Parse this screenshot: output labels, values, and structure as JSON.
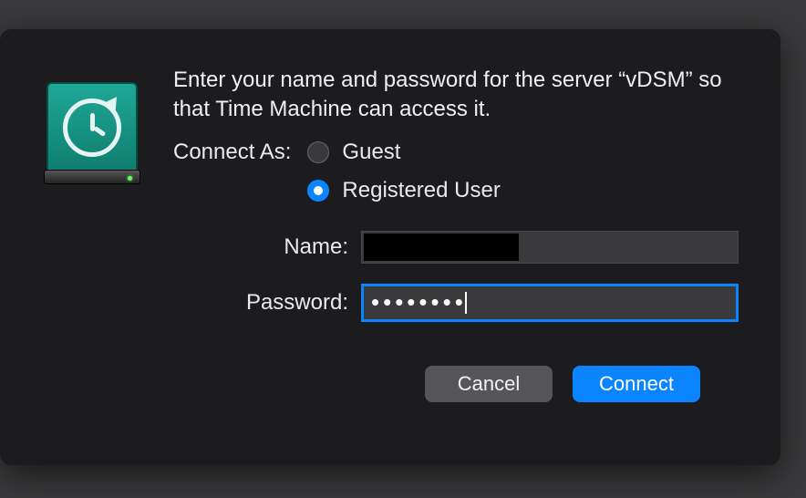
{
  "dialog": {
    "message": "Enter your name and password for the server “vDSM” so that Time Machine can access it.",
    "connect_as_label": "Connect As:",
    "options": {
      "guest": "Guest",
      "registered": "Registered User"
    },
    "selected_option": "registered",
    "fields": {
      "name_label": "Name:",
      "name_value": "",
      "password_label": "Password:",
      "password_masked": "••••••••"
    },
    "buttons": {
      "cancel": "Cancel",
      "connect": "Connect"
    }
  },
  "icon": {
    "name": "time-machine-disk-icon"
  }
}
